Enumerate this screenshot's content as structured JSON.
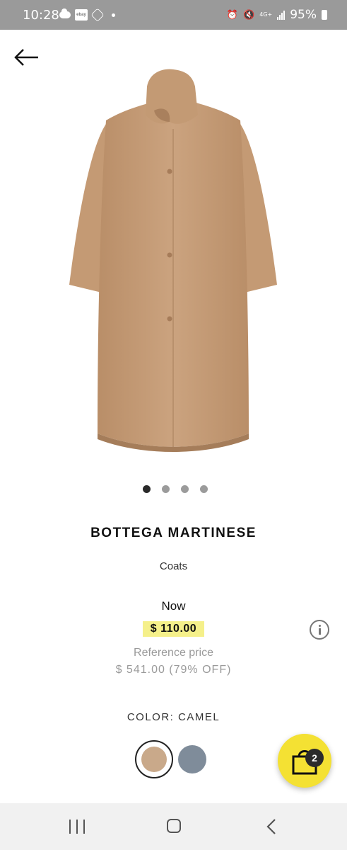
{
  "status_bar": {
    "time": "10:28",
    "battery_percent": "95%",
    "network_label": "4G+",
    "icons": [
      "cloud-icon",
      "ebay-icon",
      "hexagon-icon",
      "notification-dot-icon",
      "alarm-icon",
      "mute-icon",
      "network-4g-icon",
      "signal-icon",
      "battery-icon"
    ]
  },
  "header": {
    "back_icon": "arrow-left-icon"
  },
  "product": {
    "image_subject": "camel-coat",
    "brand": "BOTTEGA MARTINESE",
    "category": "Coats",
    "now_label": "Now",
    "price": "$ 110.00",
    "reference_label": "Reference price",
    "reference_price": "$ 541.00 (79% OFF)",
    "color_label": "COLOR: CAMEL",
    "colors": [
      {
        "hex": "#c9a98a",
        "selected": true
      },
      {
        "hex": "#7f8c9a",
        "selected": false
      }
    ],
    "carousel": {
      "count": 4,
      "active_index": 0
    }
  },
  "cart": {
    "count": "2"
  },
  "theme": {
    "price_highlight": "#f5f08a",
    "fab_color": "#f4e133",
    "coat_color": "#c9a98a"
  },
  "nav_bar": {
    "icons": [
      "recents-icon",
      "home-icon",
      "back-icon"
    ]
  }
}
